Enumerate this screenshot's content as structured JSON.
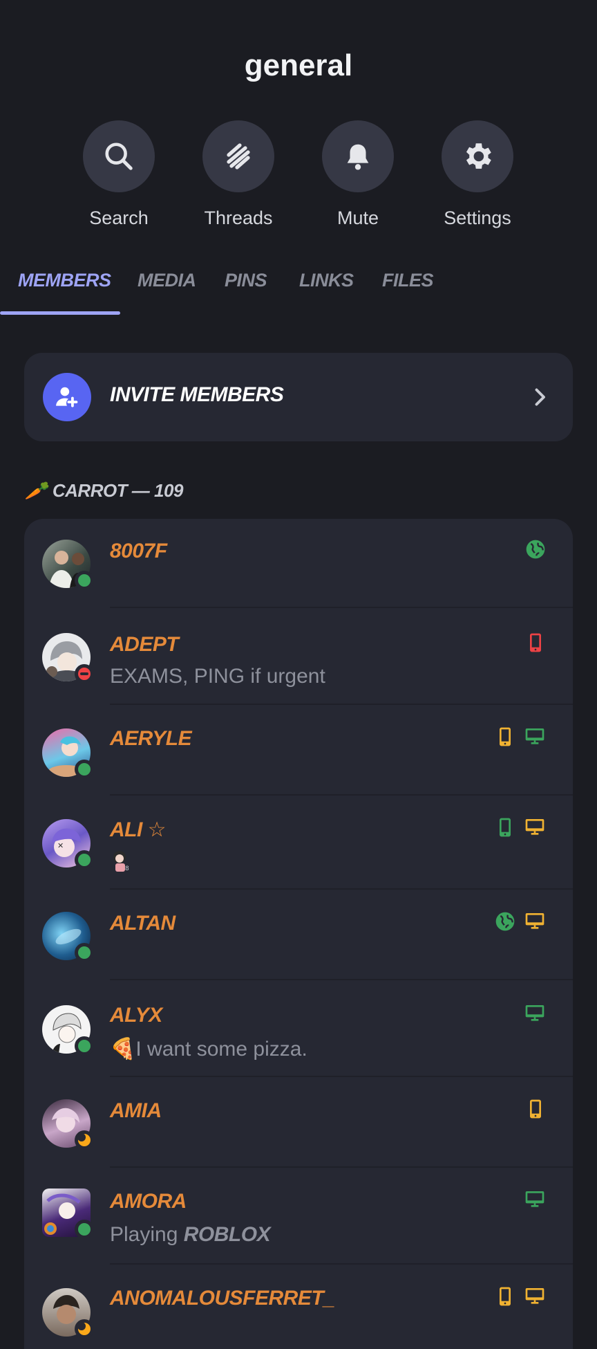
{
  "channel": {
    "title": "general"
  },
  "actions": [
    {
      "label": "Search",
      "icon": "search-icon"
    },
    {
      "label": "Threads",
      "icon": "threads-icon"
    },
    {
      "label": "Mute",
      "icon": "bell-icon"
    },
    {
      "label": "Settings",
      "icon": "gear-icon"
    }
  ],
  "tabs": [
    "MEMBERS",
    "MEDIA",
    "PINS",
    "LINKS",
    "FILES"
  ],
  "active_tab": "MEMBERS",
  "invite": {
    "label": "INVITE MEMBERS"
  },
  "section": {
    "emoji": "🥕",
    "label": "CARROT — 109"
  },
  "members": [
    {
      "name": "8007F",
      "status": "online",
      "subtitle": "",
      "devices": [
        "web"
      ]
    },
    {
      "name": "ADEPT",
      "status": "dnd",
      "subtitle": "EXAMS, PING if urgent",
      "devices": [
        "mobile"
      ]
    },
    {
      "name": "AERYLE",
      "status": "online",
      "subtitle": "",
      "devices": [
        "mobile",
        "desktop"
      ]
    },
    {
      "name": "ALI ☆",
      "status": "online",
      "subtitle": "",
      "devices": [
        "mobile",
        "desktop"
      ]
    },
    {
      "name": "ALTAN",
      "status": "online",
      "subtitle": "",
      "devices": [
        "web",
        "desktop"
      ]
    },
    {
      "name": "ALYX",
      "status": "online",
      "subtitle": "🍕I want some pizza.",
      "devices": [
        "desktop"
      ]
    },
    {
      "name": "AMIA",
      "status": "idle",
      "subtitle": "",
      "devices": [
        "mobile"
      ]
    },
    {
      "name": "AMORA",
      "status": "online",
      "subtitle_prefix": "Playing",
      "subtitle_game": "ROBLOX",
      "devices": [
        "desktop"
      ]
    },
    {
      "name": "ANOMALOUSFERRET_",
      "status": "idle",
      "subtitle": "",
      "devices": [
        "mobile",
        "desktop"
      ]
    }
  ],
  "colors": {
    "accent": "#9ea4f5",
    "invite": "#5865f2",
    "name": "#e58a3a",
    "online": "#3ba55d",
    "idle": "#faa81a",
    "dnd": "#ed4245",
    "device_green": "#3ba55d",
    "device_yellow": "#f0b232",
    "device_red": "#ed4245"
  }
}
